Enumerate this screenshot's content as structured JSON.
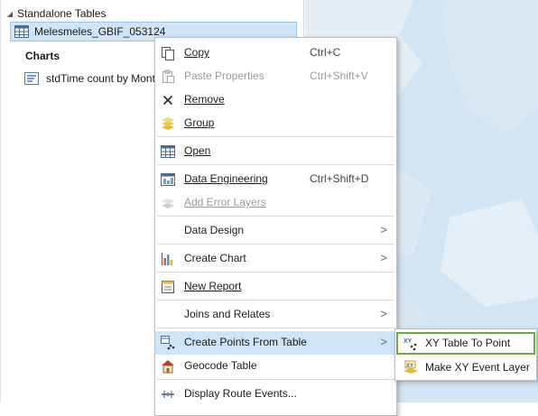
{
  "contents": {
    "group_label": "Standalone Tables",
    "table_name": "Melesmeles_GBIF_053124",
    "charts_label": "Charts",
    "chart_item": "stdTime count by Month"
  },
  "menu": {
    "items": [
      {
        "label": "Copy",
        "shortcut": "Ctrl+C",
        "icon": "copy-icon",
        "enabled": true
      },
      {
        "label": "Paste Properties",
        "shortcut": "Ctrl+Shift+V",
        "icon": "paste-icon",
        "enabled": false
      },
      {
        "label": "Remove",
        "shortcut": "",
        "icon": "close-icon",
        "enabled": true
      },
      {
        "label": "Group",
        "shortcut": "",
        "icon": "layers-icon",
        "enabled": true
      },
      {
        "label": "Open",
        "shortcut": "",
        "icon": "table-icon",
        "enabled": true
      },
      {
        "label": "Data Engineering",
        "shortcut": "Ctrl+Shift+D",
        "icon": "data-engineering-icon",
        "enabled": true
      },
      {
        "label": "Add Error Layers",
        "shortcut": "",
        "icon": "error-layers-icon",
        "enabled": false
      },
      {
        "label": "Data Design",
        "shortcut": "",
        "icon": "",
        "enabled": true,
        "submenu": true
      },
      {
        "label": "Create Chart",
        "shortcut": "",
        "icon": "chart-icon",
        "enabled": true,
        "submenu": true
      },
      {
        "label": "New Report",
        "shortcut": "",
        "icon": "report-icon",
        "enabled": true
      },
      {
        "label": "Joins and Relates",
        "shortcut": "",
        "icon": "",
        "enabled": true,
        "submenu": true
      },
      {
        "label": "Create Points From Table",
        "shortcut": "",
        "icon": "xy-points-icon",
        "enabled": true,
        "submenu": true
      },
      {
        "label": "Geocode Table",
        "shortcut": "",
        "icon": "geocode-icon",
        "enabled": true
      },
      {
        "label": "Display Route Events...",
        "shortcut": "",
        "icon": "route-events-icon",
        "enabled": true
      }
    ],
    "submenu_arrow": ">"
  },
  "submenu": {
    "items": [
      {
        "label": "XY Table To Point",
        "icon": "xy-table-to-point-icon"
      },
      {
        "label": "Make XY Event Layer",
        "icon": "xy-event-layer-icon"
      }
    ]
  },
  "colors": {
    "selection": "#cfe4f7",
    "hover": "#cde5f7",
    "highlight_border": "#6aab3a",
    "map_water": "#d5e6f4"
  }
}
